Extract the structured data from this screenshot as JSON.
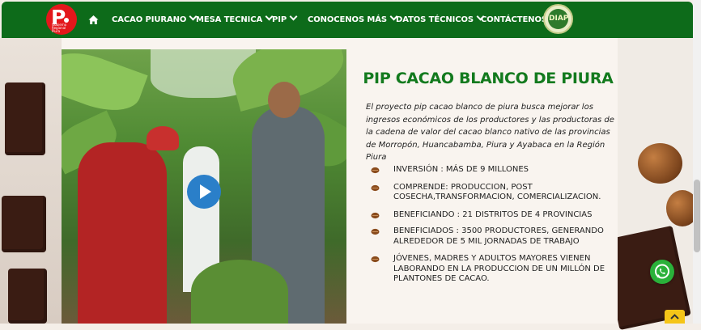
{
  "nav": {
    "logo_letter": "P",
    "logo_sub": "Gobierno Regional Piura",
    "items": [
      {
        "label": "CACAO PIURANO",
        "dropdown": true
      },
      {
        "label": "MESA TECNICA",
        "dropdown": true
      },
      {
        "label": "PIP",
        "dropdown": true
      },
      {
        "label": "CONOCENOS MÁS",
        "dropdown": true
      },
      {
        "label": "DATOS TÉCNICOS",
        "dropdown": true
      },
      {
        "label": "CONTÁCTENOS",
        "dropdown": false
      }
    ],
    "badge_text": "DIAP"
  },
  "content": {
    "title": "PIP CACAO BLANCO DE PIURA",
    "description": "El proyecto pip cacao blanco de piura busca mejorar los ingresos económicos de los productores y las productoras de la cadena de valor del cacao blanco nativo de las provincias de Morropón, Huancabamba, Piura y Ayabaca en la Región Piura",
    "bullets": [
      "INVERSIÓN : MÁS DE 9 MILLONES",
      "COMPRENDE: PRODUCCION, POST COSECHA,TRANSFORMACION, COMERCIALIZACION.",
      "BENEFICIANDO : 21 DISTRITOS DE 4 PROVINCIAS",
      "BENEFICIADOS : 3500 PRODUCTORES, GENERANDO ALREDEDOR DE 5 MIL JORNADAS DE TRABAJO",
      "JÓVENES, MADRES Y ADULTOS MAYORES VIENEN LABORANDO EN LA PRODUCCION DE UN MILLÓN DE PLANTONES DE CACAO."
    ]
  },
  "colors": {
    "nav_bg": "#0d6b1a",
    "title_green": "#137a1e",
    "play_blue": "#2a7fc9",
    "whatsapp_green": "#2ab13a",
    "totop_yellow": "#f5c518"
  },
  "icons": [
    "home-icon",
    "chevron-down-icon",
    "play-icon",
    "cacao-pod-icon",
    "whatsapp-icon",
    "chevron-up-icon"
  ]
}
